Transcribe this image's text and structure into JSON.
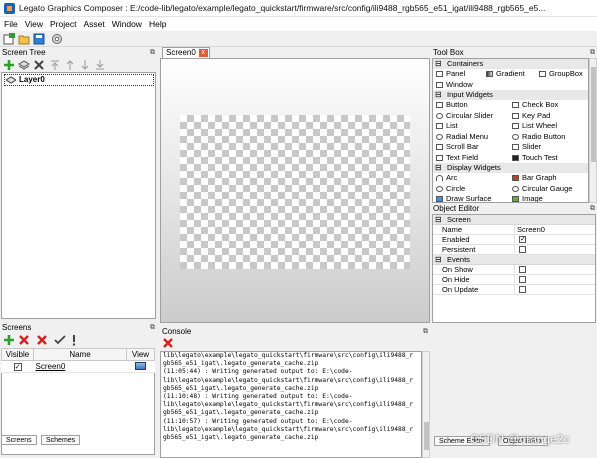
{
  "window": {
    "title": "Legato Graphics Composer : E:/code-lib/legato/example/legato_quickstart/firmware/src/config/ili9488_rgb565_e51_igat/ili9488_rgb565_e5..."
  },
  "menu": [
    "File",
    "View",
    "Project",
    "Asset",
    "Window",
    "Help"
  ],
  "screen_tree": {
    "title": "Screen Tree",
    "layer_label": "Layer0"
  },
  "editor": {
    "tab_label": "Screen0",
    "tab_close": "x"
  },
  "toolbox": {
    "title": "Tool Box",
    "groups": [
      {
        "label": "Containers",
        "rows": [
          [
            "Panel",
            "Gradient",
            "GroupBox"
          ],
          [
            "Window"
          ]
        ]
      },
      {
        "label": "Input Widgets",
        "rows": [
          [
            "Button",
            "Check Box"
          ],
          [
            "Circular Slider",
            "Key Pad"
          ],
          [
            "List",
            "List Wheel"
          ],
          [
            "Radial Menu",
            "Radio Button"
          ],
          [
            "Scroll Bar",
            "Slider"
          ],
          [
            "Text Field",
            "Touch Test"
          ]
        ]
      },
      {
        "label": "Display Widgets",
        "rows": [
          [
            "Arc",
            "Bar Graph"
          ],
          [
            "Circle",
            "Circular Gauge"
          ],
          [
            "Draw Surface",
            "Image"
          ]
        ]
      }
    ]
  },
  "object_editor": {
    "title": "Object Editor",
    "group1": "Screen",
    "name_key": "Name",
    "name_value": "Screen0",
    "enabled_key": "Enabled",
    "enabled_checked": true,
    "persistent_key": "Persistent",
    "persistent_checked": false,
    "group2": "Events",
    "events": [
      "On Show",
      "On Hide",
      "On Update"
    ]
  },
  "screens": {
    "title": "Screens",
    "columns": [
      "Visible",
      "Name",
      "View"
    ],
    "row": {
      "visible": true,
      "name": "Screen0"
    },
    "bottom_tabs": [
      "Screens",
      "Schemes"
    ]
  },
  "console": {
    "title": "Console",
    "lines": [
      "lib\\legato\\example\\legato_quickstart\\firmware\\src\\config\\ili9488_r",
      "gb565_e51_igat\\.legato_generate_cache.zip",
      "(11:05:44) : Writing generated output to: E:\\code-",
      "lib\\legato\\example\\legato_quickstart\\firmware\\src\\config\\ili9488_r",
      "gb565_e51_igat\\.legato_generate_cache.zip",
      "(11:10:48) : Writing generated output to: E:\\code-",
      "lib\\legato\\example\\legato_quickstart\\firmware\\src\\config\\ili9488_r",
      "gb565_e51_igat\\.legato_generate_cache.zip",
      "(11:10:57) : Writing generated output to: E:\\code-",
      "lib\\legato\\example\\legato_quickstart\\firmware\\src\\config\\ili9488_r",
      "gb565_e51_igat\\.legato_generate_cache.zip"
    ]
  },
  "watermark": "CSDN @orange2c",
  "bottom_right_tabs": [
    "Scheme Editor",
    "Object Editor"
  ],
  "colors": {
    "add_green": "#2e9e2e",
    "delete_red": "#d42020",
    "accent_blue": "#1f5fb5"
  }
}
